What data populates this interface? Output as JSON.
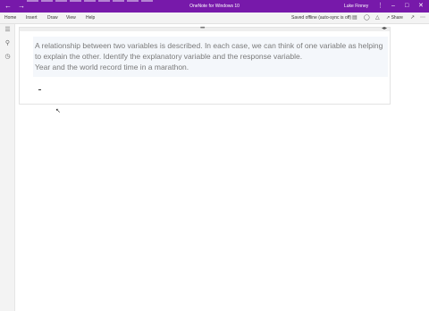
{
  "titlebar": {
    "back_icon": "back-arrow-icon",
    "forward_icon": "forward-arrow-icon",
    "title": "OneNote for Windows 10",
    "user": "Luke Finney",
    "color": "#7719aa"
  },
  "ribbon": {
    "tabs": [
      "Home",
      "Insert",
      "Draw",
      "View",
      "Help"
    ],
    "status": "Saved offline (auto-sync is off)",
    "share_label": "Share"
  },
  "note": {
    "lines": [
      "A relationship between two variables is described. In each case, we can think of one variable as helping",
      "to explain the other. Identify the explanatory variable and the response variable.",
      "Year and the world record time in a marathon."
    ]
  }
}
